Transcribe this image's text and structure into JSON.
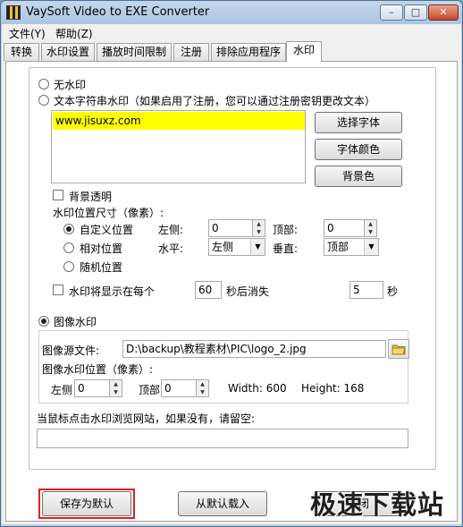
{
  "window": {
    "title": "VaySoft Video to EXE Converter",
    "min_glyph": "–",
    "max_glyph": "□",
    "close_glyph": "✕"
  },
  "menu": {
    "file": "文件(Y)",
    "help": "帮助(Z)"
  },
  "tabs": [
    {
      "label": "转换"
    },
    {
      "label": "水印设置"
    },
    {
      "label": "播放时间限制"
    },
    {
      "label": "注册"
    },
    {
      "label": "排除应用程序"
    },
    {
      "label": "水印"
    }
  ],
  "active_tab": "水印",
  "watermark": {
    "no_watermark": "无水印",
    "text_watermark": "文本字符串水印（如果启用了注册，您可以通过注册密钥更改文本）",
    "text_value": "www.jisuxz.com",
    "select_font": "选择字体",
    "font_color": "字体颜色",
    "bg_color": "背景色",
    "bg_transparent": "背景透明",
    "position_size": "水印位置尺寸（像素）:",
    "custom_position": "自定义位置",
    "left_label": "左侧:",
    "left_value": "0",
    "top_label": "顶部:",
    "top_value": "0",
    "relative_position": "相对位置",
    "horizontal_label": "水平:",
    "horizontal_value": "左侧",
    "vertical_label": "垂直:",
    "vertical_value": "顶部",
    "random_position": "随机位置",
    "show_every": "水印将显示在每个",
    "show_every_value": "60",
    "disappear_after": "秒后消失",
    "disappear_value": "5",
    "seconds": "秒",
    "image_watermark": "图像水印",
    "image_source_label": "图像源文件:",
    "image_source_value": "D:\\backup\\教程素材\\PIC\\logo_2.jpg",
    "image_position": "图像水印位置（像素）:",
    "img_left_label": "左侧",
    "img_left_value": "0",
    "img_top_label": "顶部",
    "img_top_value": "0",
    "width_text": "Width: 600",
    "height_text": "Height: 168",
    "url_prompt": "当鼠标点击水印浏览网站，如果没有，请留空:",
    "url_value": ""
  },
  "buttons": {
    "save_default": "保存为默认",
    "load_default": "从默认载入",
    "close": "关闭"
  },
  "site_watermark": "极速下载站",
  "colors": {
    "text_highlight": "#ffff00",
    "annotation_red": "#e02020"
  }
}
